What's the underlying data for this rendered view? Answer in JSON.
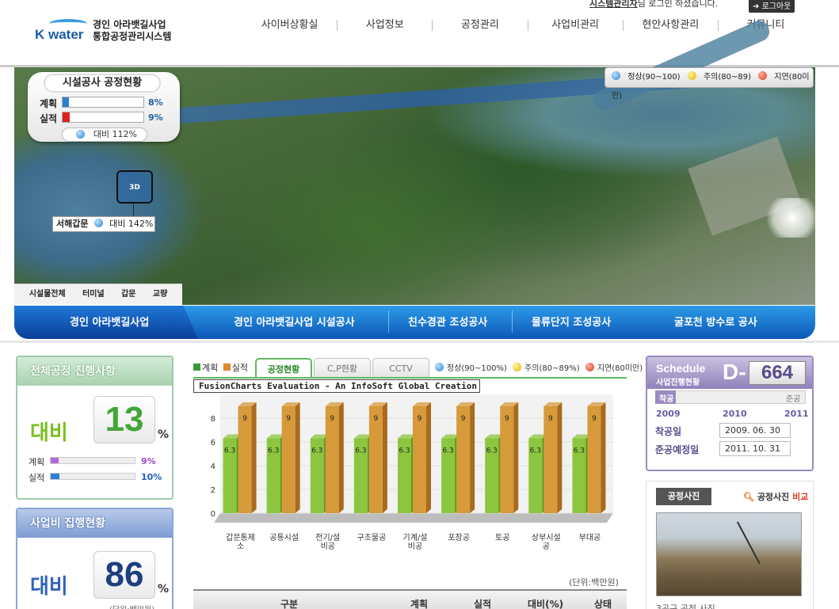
{
  "header": {
    "logo_brand": "K water",
    "logo_line1": "경인 아라뱃길사업",
    "logo_line2": "통합공정관리시스템",
    "login_user": "시스템관리자",
    "login_msg": "님 로그인 하셨습니다.",
    "logout": "로그아웃",
    "nav": [
      "사이버상황실",
      "사업정보",
      "공정관리",
      "사업비관리",
      "현안사항관리",
      "커뮤니티"
    ]
  },
  "map": {
    "status_title": "시설공사 공정현황",
    "plan_label": "계획",
    "plan_pct": "8%",
    "plan_value": 8,
    "actual_label": "실적",
    "actual_pct": "9%",
    "actual_value": 9,
    "ratio": "대비 112%",
    "legend": {
      "normal": "정상(90~100)",
      "caution": "주의(80~89)",
      "delay": "지연(80미만)"
    },
    "marker_badge": "3D",
    "marker_name": "서해갑문",
    "marker_ratio": "대비 142%",
    "tabs": [
      "시설물전체",
      "터미널",
      "갑문",
      "교량"
    ]
  },
  "band": [
    "경인 아라뱃길사업",
    "경인 아라뱃길사업 시설공사",
    "친수경관 조성공사",
    "물류단지 조성공사",
    "굴포천 방수로 공사"
  ],
  "overall": {
    "title": "전체공정 진행사항",
    "label": "대비",
    "number": "13",
    "pct": "%",
    "plan_label": "계획",
    "plan_val": "9%",
    "plan_value": 9,
    "actual_label": "실적",
    "actual_val": "10%",
    "actual_value": 10
  },
  "budget": {
    "title": "사업비 집행현황",
    "label": "대비",
    "number": "86",
    "pct": "%",
    "unit": "(단위:백만원)"
  },
  "center": {
    "legend_plan": "계획",
    "legend_actual": "실적",
    "tabs": [
      "공정현황",
      "C,P현황",
      "CCTV"
    ],
    "legend_normal": "정상(90~100%)",
    "legend_caution": "주의(80~89%)",
    "legend_delay": "지연(80미만)",
    "fc_note": "FusionCharts Evaluation - An InfoSoft Global Creation",
    "unit": "(단위:백만원)",
    "table_headers": [
      "구분",
      "계획",
      "실적",
      "대비(%)",
      "상태"
    ]
  },
  "chart_data": {
    "type": "bar",
    "categories": [
      "갑문통제소",
      "공통시설",
      "전기/설비공",
      "구조물공",
      "기계/설비공",
      "포장공",
      "토공",
      "상부시설공",
      "부대공"
    ],
    "series": [
      {
        "name": "계획",
        "values": [
          6.3,
          6.3,
          6.3,
          6.3,
          6.3,
          6.3,
          6.3,
          6.3,
          6.3
        ]
      },
      {
        "name": "실적",
        "values": [
          9,
          9,
          9,
          9,
          9,
          9,
          9,
          9,
          9
        ]
      }
    ],
    "ylim": [
      0,
      10
    ],
    "yticks": [
      0,
      2,
      4,
      6,
      8
    ],
    "colors": {
      "plan": "#8cc63f",
      "actual": "#d79a3a"
    }
  },
  "schedule": {
    "title": "Schedule",
    "subtitle": "사업진행현황",
    "dday_prefix": "D-",
    "dday": "664",
    "start_tag": "착공",
    "end_tag": "준공",
    "years": [
      "2009",
      "2010",
      "2011"
    ],
    "start_label": "착공일",
    "start_date": "2009. 06. 30",
    "end_label": "준공예정일",
    "end_date": "2011. 10. 31"
  },
  "photo": {
    "tab": "공정사진",
    "compare_prefix": "공정사진",
    "compare_red": "비교",
    "caption": "3공구 공정 사진"
  }
}
